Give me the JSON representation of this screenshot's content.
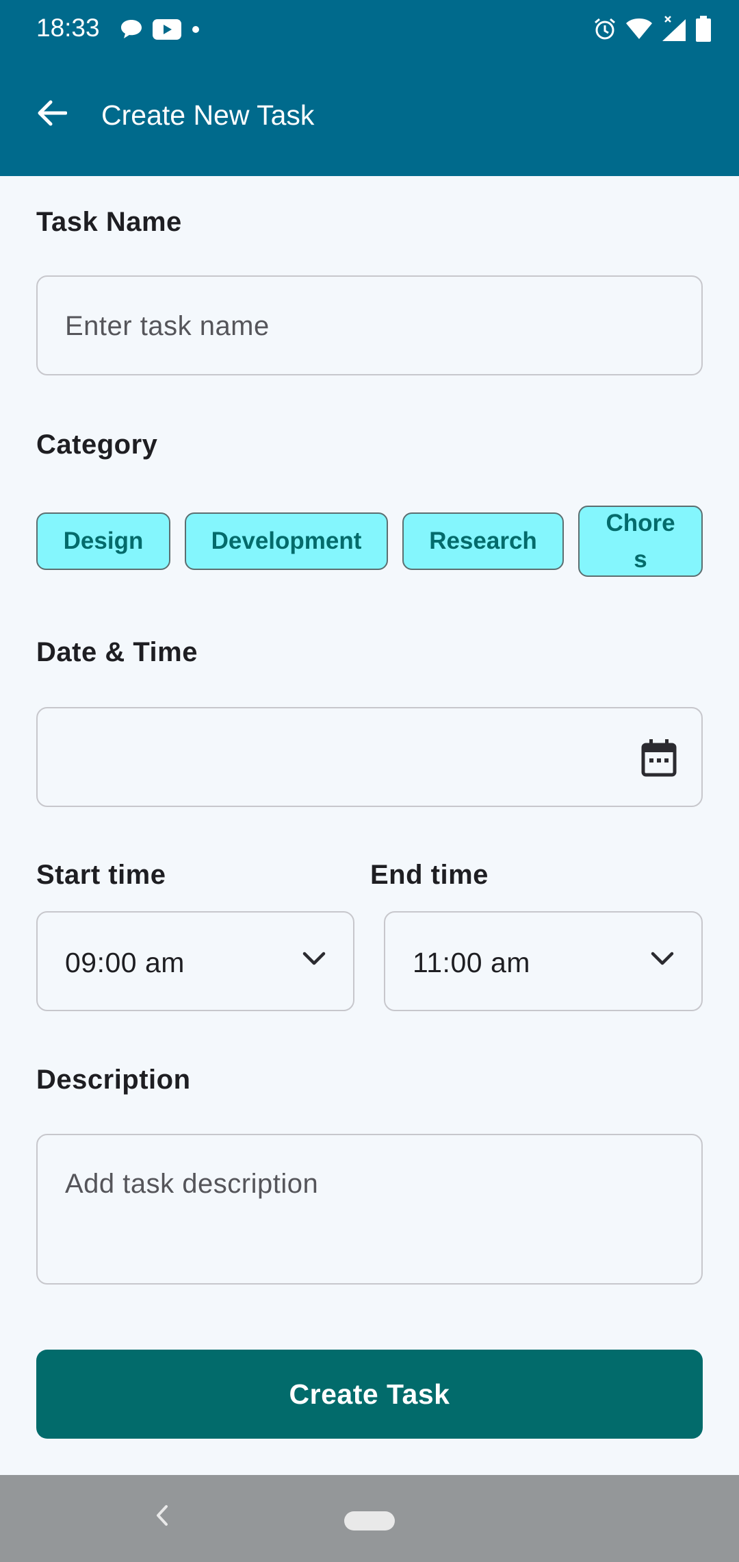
{
  "status_bar": {
    "time": "18:33",
    "notification_icons": [
      "chat-bubble-icon",
      "youtube-icon",
      "dot-icon"
    ],
    "system_icons": [
      "alarm-icon",
      "wifi-icon",
      "signal-icon",
      "battery-icon"
    ]
  },
  "app_bar": {
    "title": "Create New Task",
    "back_icon": "arrow-back-icon"
  },
  "form": {
    "task_name": {
      "label": "Task Name",
      "placeholder": "Enter task name",
      "value": ""
    },
    "category": {
      "label": "Category",
      "chips": [
        "Design",
        "Development",
        "Research",
        "Chores"
      ]
    },
    "date_time": {
      "label": "Date & Time",
      "value": "",
      "icon": "calendar-icon"
    },
    "start_time": {
      "label": "Start time",
      "value": "09:00 am"
    },
    "end_time": {
      "label": "End time",
      "value": "11:00 am"
    },
    "description": {
      "label": "Description",
      "placeholder": "Add task description",
      "value": ""
    },
    "submit_label": "Create Task"
  },
  "colors": {
    "primary": "#006a8c",
    "chip_fill": "#84f6fd",
    "chip_text": "#046b6b",
    "button": "#026b6b",
    "background": "#f4f8fc"
  }
}
